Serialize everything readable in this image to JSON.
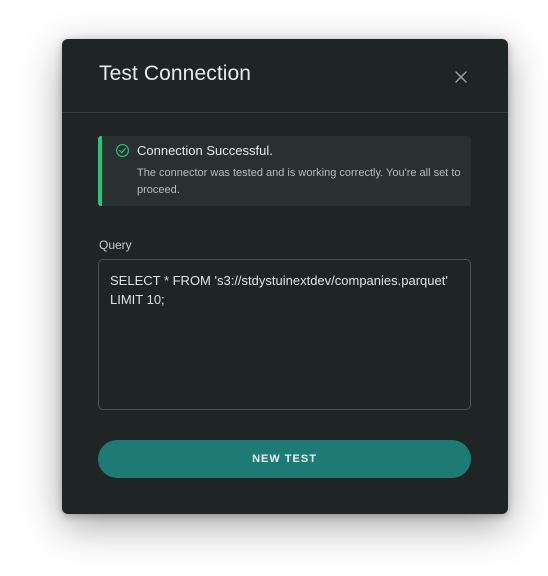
{
  "dialog": {
    "title": "Test Connection",
    "close_icon": "close-icon"
  },
  "alert": {
    "status": "success",
    "icon": "check-circle-icon",
    "accent_color": "#1fc97a",
    "title": "Connection Successful.",
    "message": "The connector was tested and is working correctly. You're all set to proceed."
  },
  "query": {
    "label": "Query",
    "value": "SELECT * FROM 's3://stdystuinextdev/companies.parquet'\nLIMIT 10;"
  },
  "actions": {
    "new_test_label": "NEW TEST",
    "button_color": "#1e7a75"
  }
}
